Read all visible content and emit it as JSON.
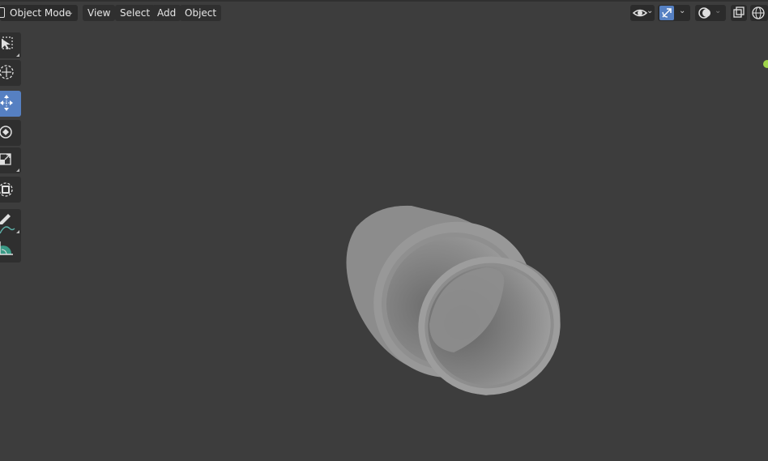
{
  "header": {
    "mode_label": "Object Mode",
    "menus": [
      "View",
      "Select",
      "Add",
      "Object"
    ]
  },
  "toolbar": {
    "tools": [
      {
        "name": "select-box",
        "icon": "select-box-icon",
        "active": false
      },
      {
        "name": "cursor",
        "icon": "cursor-icon",
        "active": false
      },
      {
        "name": "move",
        "icon": "move-icon",
        "active": true
      },
      {
        "name": "rotate",
        "icon": "rotate-icon",
        "active": false
      },
      {
        "name": "scale",
        "icon": "scale-icon",
        "active": false
      },
      {
        "name": "transform",
        "icon": "transform-icon",
        "active": false
      },
      {
        "name": "annotate",
        "icon": "annotate-icon",
        "active": false
      },
      {
        "name": "measure",
        "icon": "measure-icon",
        "active": false
      }
    ]
  },
  "colors": {
    "viewport_bg": "#3d3d3d",
    "button_bg": "#2b2b2b",
    "active_tool": "#5680c2",
    "object_gray": "#8a8a8a",
    "active_indicator": "#9fd44a"
  }
}
